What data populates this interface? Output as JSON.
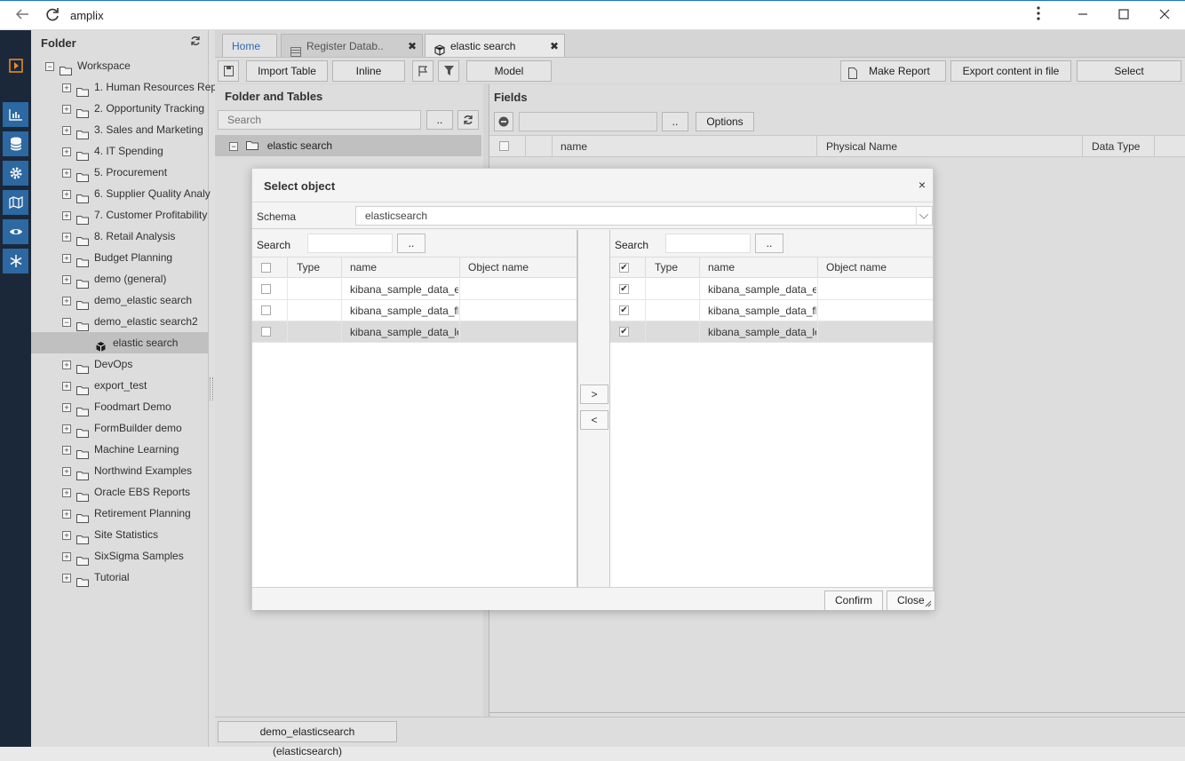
{
  "window": {
    "title": "amplix"
  },
  "folder_panel": {
    "title": "Folder",
    "items": [
      {
        "label": "Workspace",
        "sign": "−"
      },
      {
        "label": "1. Human Resources Rep",
        "sign": "+"
      },
      {
        "label": "2. Opportunity Tracking",
        "sign": "+"
      },
      {
        "label": "3. Sales and Marketing",
        "sign": "+"
      },
      {
        "label": "4. IT Spending",
        "sign": "+"
      },
      {
        "label": "5. Procurement",
        "sign": "+"
      },
      {
        "label": "6. Supplier Quality Analy",
        "sign": "+"
      },
      {
        "label": "7. Customer Profitability",
        "sign": "+"
      },
      {
        "label": "8. Retail Analysis",
        "sign": "+"
      },
      {
        "label": "Budget Planning",
        "sign": "+"
      },
      {
        "label": "demo (general)",
        "sign": "+"
      },
      {
        "label": "demo_elastic search",
        "sign": "+"
      },
      {
        "label": "demo_elastic search2",
        "sign": "−"
      },
      {
        "label": "elastic search",
        "sign": ""
      },
      {
        "label": "DevOps",
        "sign": "+"
      },
      {
        "label": "export_test",
        "sign": "+"
      },
      {
        "label": "Foodmart Demo",
        "sign": "+"
      },
      {
        "label": "FormBuilder demo",
        "sign": "+"
      },
      {
        "label": "Machine Learning",
        "sign": "+"
      },
      {
        "label": "Northwind Examples",
        "sign": "+"
      },
      {
        "label": "Oracle EBS Reports",
        "sign": "+"
      },
      {
        "label": "Retirement Planning",
        "sign": "+"
      },
      {
        "label": "Site Statistics",
        "sign": "+"
      },
      {
        "label": "SixSigma Samples",
        "sign": "+"
      },
      {
        "label": "Tutorial",
        "sign": "+"
      }
    ]
  },
  "tabs": [
    {
      "label": "Home"
    },
    {
      "label": "Register Datab.."
    },
    {
      "label": "elastic search"
    }
  ],
  "toolbar": {
    "import_table": "Import Table",
    "inline_view": "Inline View",
    "model_wizard": "Model Wizard",
    "make_report": "Make Report",
    "export_content": "Export content in file",
    "select_datasource": "Select Datasource"
  },
  "folder_and_tables": {
    "title": "Folder and Tables",
    "search_placeholder": "Search",
    "dots": "..",
    "node": "elastic search"
  },
  "fields": {
    "title": "Fields",
    "dots": "..",
    "options": "Options",
    "columns": [
      "name",
      "Physical Name",
      "Data Type"
    ]
  },
  "dialog": {
    "title": "Select object",
    "close_x": "×",
    "schema_label": "Schema",
    "schema_value": "elasticsearch",
    "search_label": "Search",
    "dots": "..",
    "columns": {
      "type": "Type",
      "name": "name",
      "object_name": "Object name"
    },
    "left_rows": [
      {
        "name": "kibana_sample_data_ecommerce",
        "checked": false
      },
      {
        "name": "kibana_sample_data_flights",
        "checked": false
      },
      {
        "name": "kibana_sample_data_logs",
        "checked": false
      }
    ],
    "right_rows": [
      {
        "name": "kibana_sample_data_ecommerce",
        "checked": true
      },
      {
        "name": "kibana_sample_data_flights",
        "checked": true
      },
      {
        "name": "kibana_sample_data_logs",
        "checked": true
      }
    ],
    "move_right": ">",
    "move_left": "<",
    "confirm": "Confirm",
    "close": "Close"
  },
  "status": {
    "datasource": "demo_elasticsearch (elasticsearch)"
  },
  "colors": {
    "rail": "#1c2a3d",
    "rail_active": "#2e6da8",
    "accent_orange": "#f0912c",
    "tab_link": "#2c6fb7"
  }
}
